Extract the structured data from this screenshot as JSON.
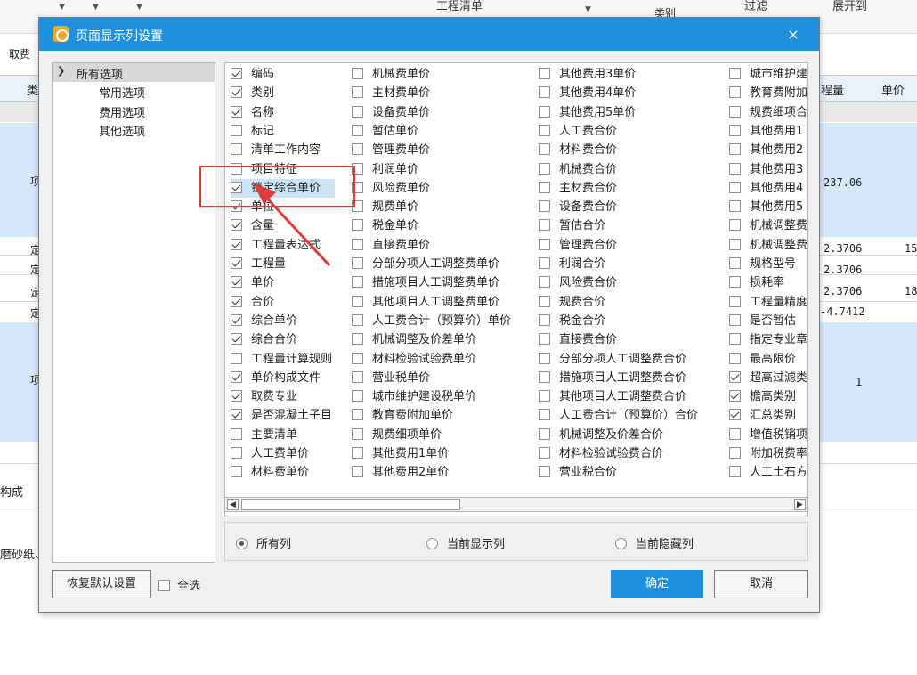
{
  "background": {
    "toolbar_items": [
      "工程清单",
      "类别",
      "过滤",
      "展开到"
    ],
    "tab_label": "取费",
    "header_cells": [
      "类",
      "程量",
      "单价"
    ],
    "side_labels": [
      "项",
      "定",
      "定",
      "定",
      "定",
      "项"
    ],
    "values": [
      "237.06",
      "2.3706",
      "2.3706",
      "2.3706",
      "-4.7412",
      "1"
    ],
    "right_values": [
      "15",
      "18"
    ],
    "bottom_labels": [
      "构成",
      "磨砂纸、"
    ]
  },
  "dialog": {
    "title": "页面显示列设置",
    "close": "×",
    "tree": {
      "root": "所有选项",
      "children": [
        "常用选项",
        "费用选项",
        "其他选项"
      ]
    },
    "columns": [
      [
        {
          "label": "编码",
          "checked": true
        },
        {
          "label": "类别",
          "checked": true
        },
        {
          "label": "名称",
          "checked": true
        },
        {
          "label": "标记",
          "checked": false
        },
        {
          "label": "清单工作内容",
          "checked": false
        },
        {
          "label": "项目特征",
          "checked": false
        },
        {
          "label": "锁定综合单价",
          "checked": true
        },
        {
          "label": "单位",
          "checked": true
        },
        {
          "label": "含量",
          "checked": true
        },
        {
          "label": "工程量表达式",
          "checked": true
        },
        {
          "label": "工程量",
          "checked": true
        },
        {
          "label": "单价",
          "checked": true
        },
        {
          "label": "合价",
          "checked": true
        },
        {
          "label": "综合单价",
          "checked": true
        },
        {
          "label": "综合合价",
          "checked": true
        },
        {
          "label": "工程量计算规则",
          "checked": false
        },
        {
          "label": "单价构成文件",
          "checked": true
        },
        {
          "label": "取费专业",
          "checked": true
        },
        {
          "label": "是否混凝土子目",
          "checked": true
        },
        {
          "label": "主要清单",
          "checked": false
        },
        {
          "label": "人工费单价",
          "checked": false
        },
        {
          "label": "材料费单价",
          "checked": false
        }
      ],
      [
        {
          "label": "机械费单价",
          "checked": false
        },
        {
          "label": "主材费单价",
          "checked": false
        },
        {
          "label": "设备费单价",
          "checked": false
        },
        {
          "label": "暂估单价",
          "checked": false
        },
        {
          "label": "管理费单价",
          "checked": false
        },
        {
          "label": "利润单价",
          "checked": false
        },
        {
          "label": "风险费单价",
          "checked": false
        },
        {
          "label": "规费单价",
          "checked": false
        },
        {
          "label": "税金单价",
          "checked": false
        },
        {
          "label": "直接费单价",
          "checked": false
        },
        {
          "label": "分部分项人工调整费单价",
          "checked": false
        },
        {
          "label": "措施项目人工调整费单价",
          "checked": false
        },
        {
          "label": "其他项目人工调整费单价",
          "checked": false
        },
        {
          "label": "人工费合计（预算价）单价",
          "checked": false
        },
        {
          "label": "机械调整及价差单价",
          "checked": false
        },
        {
          "label": "材料检验试验费单价",
          "checked": false
        },
        {
          "label": "营业税单价",
          "checked": false
        },
        {
          "label": "城市维护建设税单价",
          "checked": false
        },
        {
          "label": "教育费附加单价",
          "checked": false
        },
        {
          "label": "规费细项单价",
          "checked": false
        },
        {
          "label": "其他费用1单价",
          "checked": false
        },
        {
          "label": "其他费用2单价",
          "checked": false
        }
      ],
      [
        {
          "label": "其他费用3单价",
          "checked": false
        },
        {
          "label": "其他费用4单价",
          "checked": false
        },
        {
          "label": "其他费用5单价",
          "checked": false
        },
        {
          "label": "人工费合价",
          "checked": false
        },
        {
          "label": "材料费合价",
          "checked": false
        },
        {
          "label": "机械费合价",
          "checked": false
        },
        {
          "label": "主材费合价",
          "checked": false
        },
        {
          "label": "设备费合价",
          "checked": false
        },
        {
          "label": "暂估合价",
          "checked": false
        },
        {
          "label": "管理费合价",
          "checked": false
        },
        {
          "label": "利润合价",
          "checked": false
        },
        {
          "label": "风险费合价",
          "checked": false
        },
        {
          "label": "规费合价",
          "checked": false
        },
        {
          "label": "税金合价",
          "checked": false
        },
        {
          "label": "直接费合价",
          "checked": false
        },
        {
          "label": "分部分项人工调整费合价",
          "checked": false
        },
        {
          "label": "措施项目人工调整费合价",
          "checked": false
        },
        {
          "label": "其他项目人工调整费合价",
          "checked": false
        },
        {
          "label": "人工费合计（预算价）合价",
          "checked": false
        },
        {
          "label": "机械调整及价差合价",
          "checked": false
        },
        {
          "label": "材料检验试验费合价",
          "checked": false
        },
        {
          "label": "营业税合价",
          "checked": false
        }
      ],
      [
        {
          "label": "城市维护建",
          "checked": false
        },
        {
          "label": "教育费附加",
          "checked": false
        },
        {
          "label": "规费细项合",
          "checked": false
        },
        {
          "label": "其他费用1",
          "checked": false
        },
        {
          "label": "其他费用2",
          "checked": false
        },
        {
          "label": "其他费用3",
          "checked": false
        },
        {
          "label": "其他费用4",
          "checked": false
        },
        {
          "label": "其他费用5",
          "checked": false
        },
        {
          "label": "机械调整费",
          "checked": false
        },
        {
          "label": "机械调整费",
          "checked": false
        },
        {
          "label": "规格型号",
          "checked": false
        },
        {
          "label": "损耗率",
          "checked": false
        },
        {
          "label": "工程量精度",
          "checked": false
        },
        {
          "label": "是否暂估",
          "checked": false
        },
        {
          "label": "指定专业章",
          "checked": false
        },
        {
          "label": "最高限价",
          "checked": false
        },
        {
          "label": "超高过滤类",
          "checked": true
        },
        {
          "label": "檐高类别",
          "checked": true
        },
        {
          "label": "汇总类别",
          "checked": true
        },
        {
          "label": "增值税销项",
          "checked": false
        },
        {
          "label": "附加税费率",
          "checked": false
        },
        {
          "label": "人工土石方",
          "checked": false
        }
      ]
    ],
    "radios": [
      {
        "label": "所有列",
        "selected": true
      },
      {
        "label": "当前显示列",
        "selected": false
      },
      {
        "label": "当前隐藏列",
        "selected": false
      }
    ],
    "reset_button": "恢复默认设置",
    "select_all": "全选",
    "ok_button": "确定",
    "cancel_button": "取消"
  },
  "colors": {
    "accent": "#1f8fe0",
    "annotation": "#e03b3b",
    "highlight": "#cce4f7"
  }
}
